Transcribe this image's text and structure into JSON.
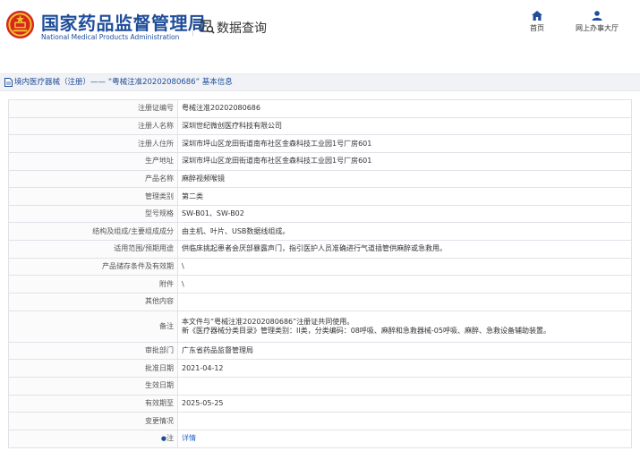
{
  "header": {
    "logo_cn": "国家药品监督管理局",
    "logo_en": "National Medical Products Administration",
    "search_label": "数据查询",
    "nav": [
      {
        "label": "首页",
        "icon": "home-icon"
      },
      {
        "label": "网上办事大厅",
        "icon": "user-icon"
      }
    ]
  },
  "colors": {
    "brand_blue": "#1f4d9a",
    "emblem_red": "#d7281c",
    "emblem_gold": "#f2c230",
    "link_blue": "#2a66c6"
  },
  "breadcrumb": "境内医疗器械（注册）—— “粤械注准20202080686” 基本信息",
  "rows": [
    {
      "label": "注册证编号",
      "value": "粤械注准20202080686"
    },
    {
      "label": "注册人名称",
      "value": "深圳世纪微创医疗科技有限公司"
    },
    {
      "label": "注册人住所",
      "value": "深圳市坪山区龙田街道南布社区金森科技工业园1号厂房601"
    },
    {
      "label": "生产地址",
      "value": "深圳市坪山区龙田街道南布社区金森科技工业园1号厂房601"
    },
    {
      "label": "产品名称",
      "value": "麻醉视频喉镜"
    },
    {
      "label": "管理类别",
      "value": "第二类"
    },
    {
      "label": "型号规格",
      "value": "SW-B01、SW-B02"
    },
    {
      "label": "结构及组成/主要组成成分",
      "value": "由主机、叶片、USB数据线组成。"
    },
    {
      "label": "适用范围/预期用途",
      "value": "供临床挑起患者会厌部暴露声门，指引医护人员准确进行气道插管供麻醉或急救用。"
    },
    {
      "label": "产品储存条件及有效期",
      "value": "\\"
    },
    {
      "label": "附件",
      "value": "\\"
    },
    {
      "label": "其他内容",
      "value": ""
    },
    {
      "label": "备注",
      "value_line1": "本文件与“粤械注准20202080686”注册证共同使用。",
      "value_line2": "新《医疗器械分类目录》管理类别：II类，分类编码：08呼吸、麻醉和急救器械-05呼吸、麻醉、急救设备辅助装置。"
    },
    {
      "label": "审批部门",
      "value": "广东省药品监督管理局"
    },
    {
      "label": "批准日期",
      "value": "2021-04-12"
    },
    {
      "label": "生效日期",
      "value": ""
    },
    {
      "label": "有效期至",
      "value": "2025-05-25"
    },
    {
      "label": "变更情况",
      "value": ""
    },
    {
      "label": "注",
      "value": "详情",
      "icon": "bullet-icon"
    }
  ]
}
